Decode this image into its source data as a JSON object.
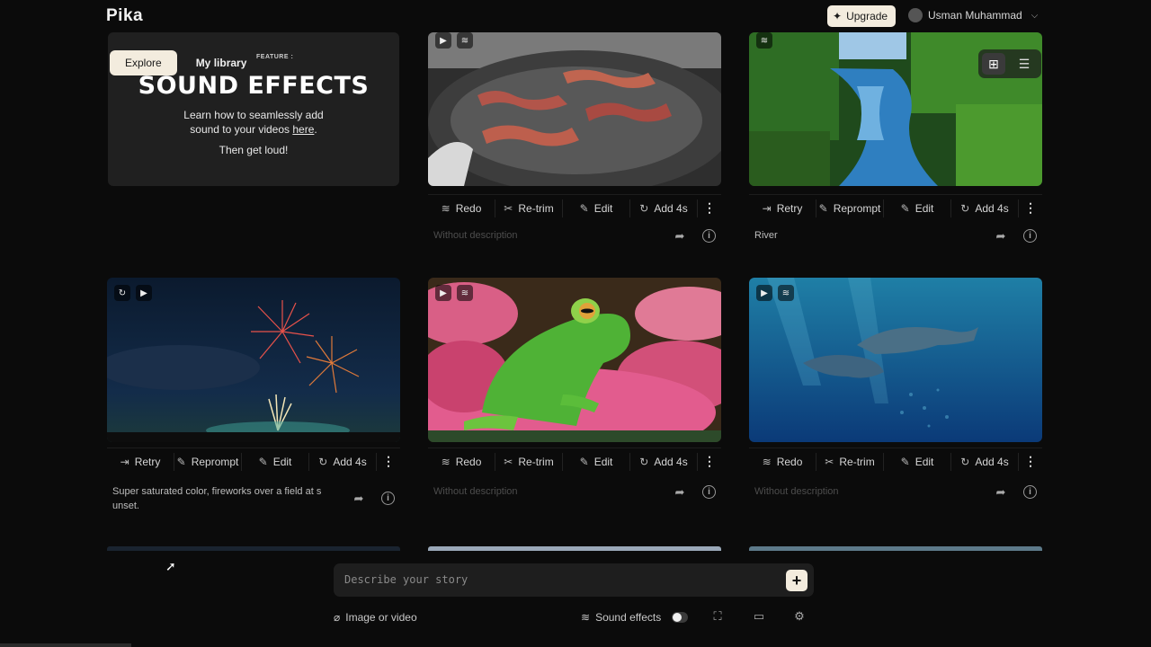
{
  "app": {
    "logo": "Pika"
  },
  "header": {
    "upgrade_label": "Upgrade",
    "user_name": "Usman Muhammad"
  },
  "tabs": [
    {
      "label": "Explore",
      "active": true
    },
    {
      "label": "My library",
      "active": false
    }
  ],
  "feature": {
    "label": "FEATURE :",
    "title": "SOUND EFFECTS",
    "body_line1": "Learn how to seamlessly add",
    "body_line2_prefix": "sound to your videos ",
    "body_link": "here",
    "body_line2_suffix": ".",
    "cta": "Then get loud!"
  },
  "cards": [
    {
      "id": "bacon",
      "actions": [
        "Redo",
        "Re-trim",
        "Edit",
        "Add 4s"
      ],
      "description": "Without description",
      "muted": true
    },
    {
      "id": "river",
      "actions": [
        "Retry",
        "Reprompt",
        "Edit",
        "Add 4s"
      ],
      "description": "River",
      "muted": false
    },
    {
      "id": "fireworks",
      "actions": [
        "Retry",
        "Reprompt",
        "Edit",
        "Add 4s"
      ],
      "description": "Super saturated color, fireworks over a field at s unset.",
      "muted": false
    },
    {
      "id": "frog",
      "actions": [
        "Redo",
        "Re-trim",
        "Edit",
        "Add 4s"
      ],
      "description": "Without description",
      "muted": true
    },
    {
      "id": "dolphins",
      "actions": [
        "Redo",
        "Re-trim",
        "Edit",
        "Add 4s"
      ],
      "description": "Without description",
      "muted": true
    }
  ],
  "composer": {
    "placeholder": "Describe your story"
  },
  "bottom": {
    "attach_label": "Image or video",
    "sound_label": "Sound effects",
    "sound_enabled": false
  },
  "colors": {
    "accent": "#f3ecde",
    "background": "#0b0b0b",
    "card": "#202020"
  }
}
